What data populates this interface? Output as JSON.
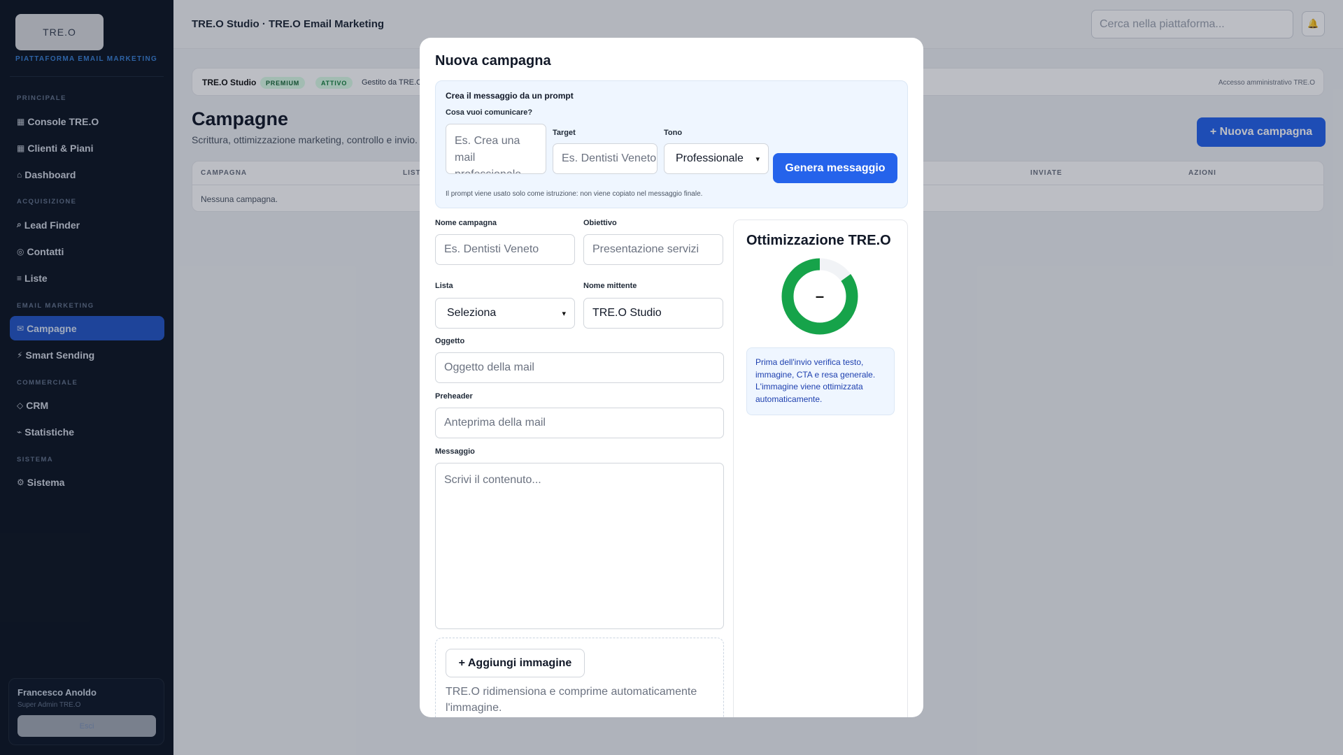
{
  "sidebar": {
    "logo": "TRE.O",
    "subtitle": "PIATTAFORMA EMAIL MARKETING",
    "sections": {
      "principale": "PRINCIPALE",
      "acquisizione": "ACQUISIZIONE",
      "email": "EMAIL MARKETING",
      "commerciale": "COMMERCIALE",
      "sistema": "SISTEMA"
    },
    "items": [
      {
        "icon": "▦",
        "label": "Console TRE.O"
      },
      {
        "icon": "▦",
        "label": "Clienti & Piani"
      },
      {
        "icon": "⌂",
        "label": "Dashboard"
      },
      {
        "icon": "⌕",
        "label": "Lead Finder"
      },
      {
        "icon": "◎",
        "label": "Contatti"
      },
      {
        "icon": "≡",
        "label": "Liste"
      },
      {
        "icon": "✉",
        "label": "Campagne"
      },
      {
        "icon": "⚡",
        "label": "Smart Sending"
      },
      {
        "icon": "◇",
        "label": "CRM"
      },
      {
        "icon": "⌁",
        "label": "Statistiche"
      },
      {
        "icon": "⚙",
        "label": "Sistema"
      }
    ],
    "user": {
      "name": "Francesco Anoldo",
      "role": "Super Admin TRE.O",
      "button": "Esci"
    }
  },
  "topbar": {
    "title": "TRE.O Studio · TRE.O Email Marketing",
    "search_placeholder": "Cerca nella piattaforma...",
    "bell": "🔔"
  },
  "studio_bar": {
    "name": "TRE.O Studio",
    "badge_premium": "PREMIUM",
    "badge_status": "ATTIVO",
    "managed": "Gestito da TRE.O",
    "admin": "Accesso amministrativo TRE.O"
  },
  "page": {
    "title": "Campagne",
    "subtitle": "Scrittura, ottimizzazione marketing, controllo e invio.",
    "new_button": "+ Nuova campagna"
  },
  "table": {
    "columns": [
      "CAMPAGNA",
      "LISTA",
      "INVIATE",
      "AZIONI"
    ],
    "empty": "Nessuna campagna."
  },
  "modal": {
    "title": "Nuova campagna",
    "prompt": {
      "title": "Crea il messaggio da un prompt",
      "question_label": "Cosa vuoi comunicare?",
      "question_placeholder": "Es. Crea una mail professionale",
      "target_label": "Target",
      "target_placeholder": "Es. Dentisti Veneto",
      "tone_label": "Tono",
      "tone_value": "Professionale",
      "generate_button": "Genera messaggio",
      "note": "Il prompt viene usato solo come istruzione: non viene copiato nel messaggio finale."
    },
    "form": {
      "name_label": "Nome campagna",
      "name_placeholder": "Es. Dentisti Veneto",
      "goal_label": "Obiettivo",
      "goal_placeholder": "Presentazione servizi",
      "list_label": "Lista",
      "list_value": "Seleziona",
      "sender_label": "Nome mittente",
      "sender_value": "TRE.O Studio",
      "subject_label": "Oggetto",
      "subject_placeholder": "Oggetto della mail",
      "preheader_label": "Preheader",
      "preheader_placeholder": "Anteprima della mail",
      "message_label": "Messaggio",
      "message_placeholder": "Scrivi il contenuto...",
      "image_button": "+ Aggiungi immagine",
      "image_note": "TRE.O ridimensiona e comprime automaticamente l'immagine."
    },
    "optimization": {
      "title": "Ottimizzazione TRE.O",
      "score": "–",
      "gauge_fraction": 0.85,
      "note": "Prima dell'invio verifica testo, immagine, CTA e resa generale. L'immagine viene ottimizzata automaticamente."
    }
  },
  "colors": {
    "accent": "#2563eb",
    "gauge": "#16a34a",
    "sidebar_bg": "#0d1522"
  }
}
